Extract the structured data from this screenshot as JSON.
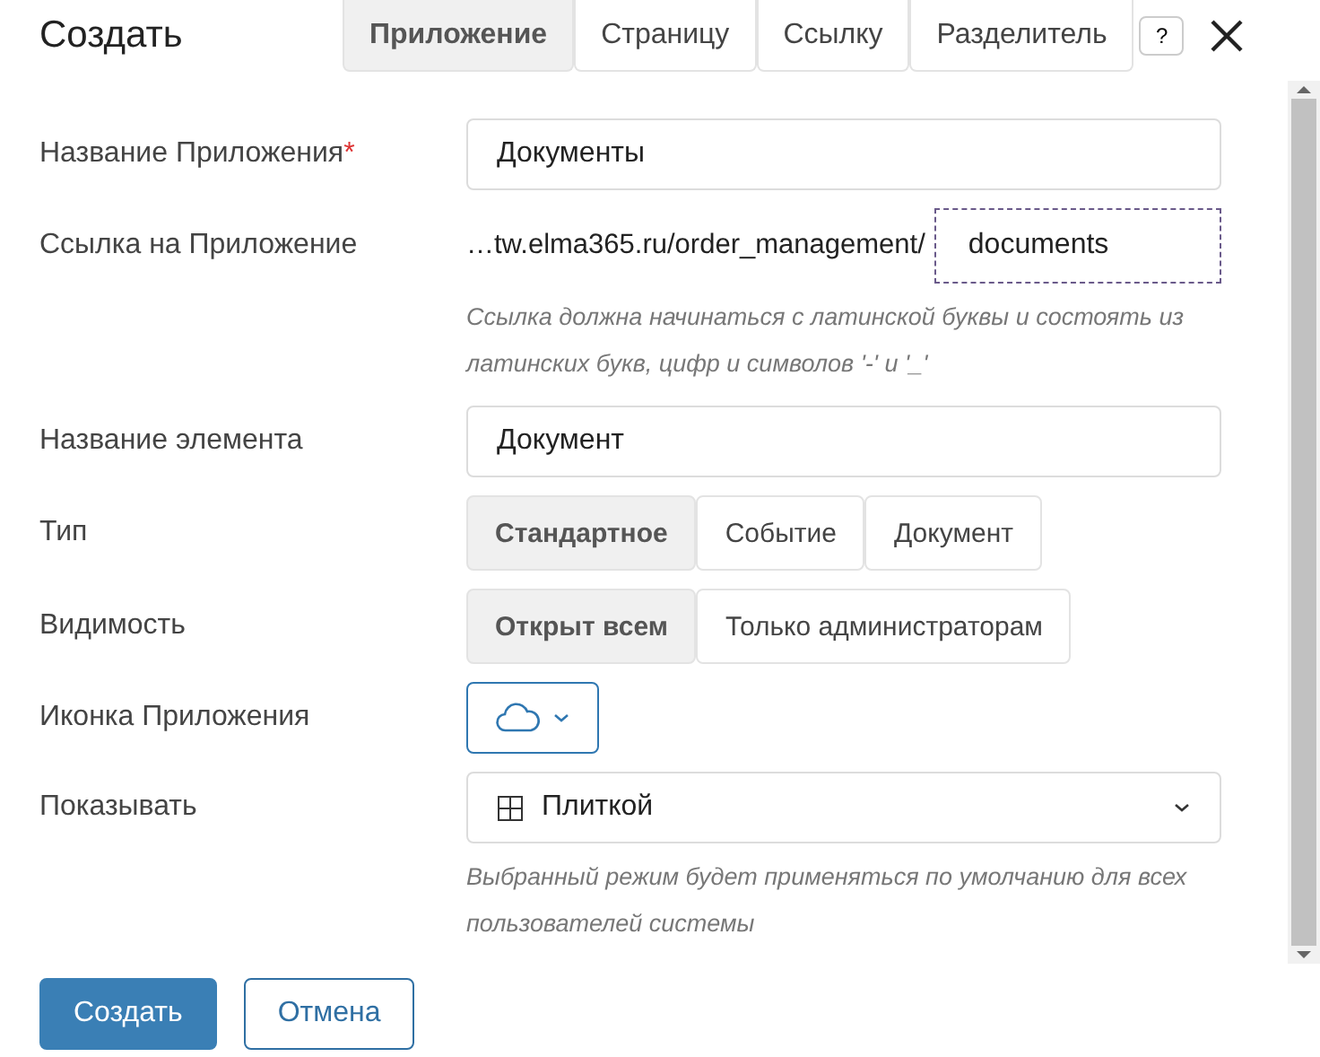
{
  "title": "Создать",
  "tabs": [
    {
      "label": "Приложение",
      "selected": true
    },
    {
      "label": "Страницу",
      "selected": false
    },
    {
      "label": "Ссылку",
      "selected": false
    },
    {
      "label": "Разделитель",
      "selected": false
    }
  ],
  "help": "?",
  "fields": [
    {
      "kind": "input",
      "label": "Название Приложения",
      "required_mark": "*",
      "value": "Документы"
    },
    {
      "kind": "link",
      "label": "Ссылка на Приложение",
      "prefix": "…tw.elma365.ru/order_management/",
      "value": "documents",
      "hint": "Ссылка должна начинаться с латинской буквы и состоять из латинских букв, цифр и символов '-' и '_'"
    },
    {
      "kind": "input",
      "label": "Название элемента",
      "value": "Документ"
    },
    {
      "kind": "segments",
      "label": "Тип",
      "options": [
        {
          "label": "Стандартное",
          "selected": true
        },
        {
          "label": "Событие",
          "selected": false
        },
        {
          "label": "Документ",
          "selected": false
        }
      ]
    },
    {
      "kind": "segments",
      "label": "Видимость",
      "options": [
        {
          "label": "Открыт всем",
          "selected": true
        },
        {
          "label": "Только администраторам",
          "selected": false
        }
      ]
    },
    {
      "kind": "icon",
      "label": "Иконка Приложения"
    },
    {
      "kind": "select",
      "label": "Показывать",
      "value": "Плиткой",
      "hint": "Выбранный режим будет применяться по умолчанию для всех пользователей системы"
    }
  ],
  "buttons": [
    {
      "label": "Создать",
      "kind": "primary"
    },
    {
      "label": "Отмена",
      "kind": "secondary"
    }
  ]
}
